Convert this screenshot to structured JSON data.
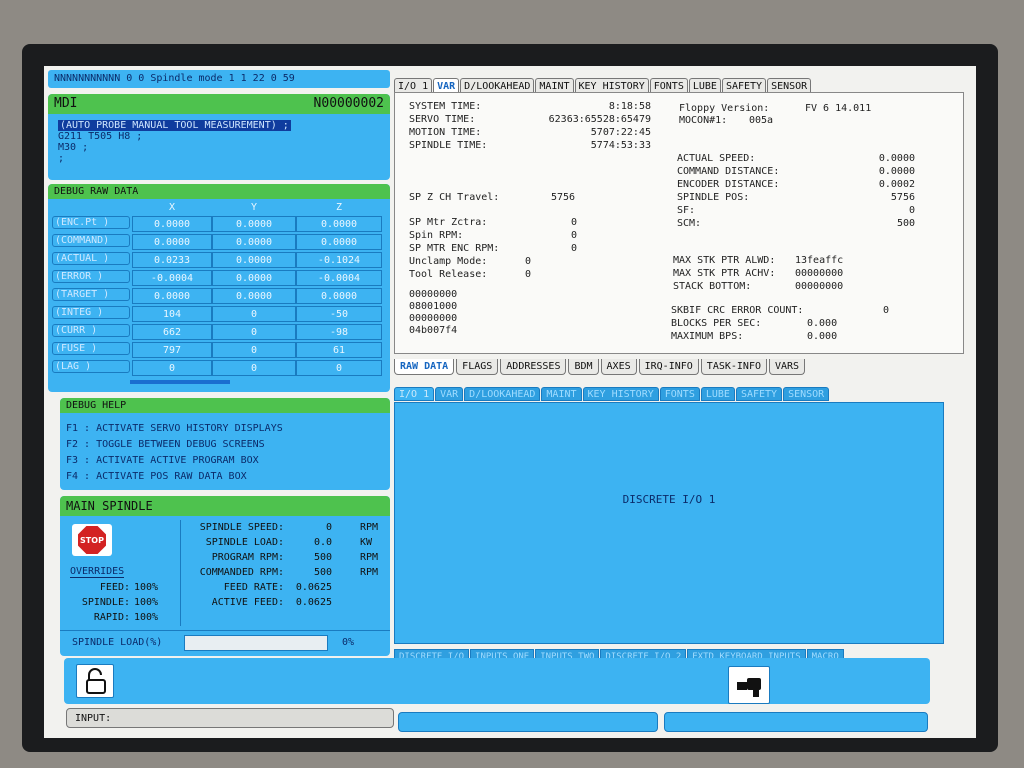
{
  "status_bar": {
    "text": "NNNNNNNNNNN   0   0 Spindle mode 1  1  22   0  59"
  },
  "mdi": {
    "title": "MDI",
    "program_number": "N00000002",
    "lines": [
      "(AUTO PROBE MANUAL TOOL MEASUREMENT) ;",
      "G211 T505 H8 ;",
      "M30 ;",
      ";"
    ]
  },
  "debug_raw": {
    "title": "DEBUG RAW DATA",
    "columns": [
      "X",
      "Y",
      "Z"
    ],
    "rows": [
      {
        "label": "(ENC.Pt )",
        "values": [
          "0.0000",
          "0.0000",
          "0.0000"
        ]
      },
      {
        "label": "(COMMAND)",
        "values": [
          "0.0000",
          "0.0000",
          "0.0000"
        ]
      },
      {
        "label": "(ACTUAL )",
        "values": [
          "0.0233",
          "0.0000",
          "-0.1024"
        ]
      },
      {
        "label": "(ERROR  )",
        "values": [
          "-0.0004",
          "0.0000",
          "-0.0004"
        ]
      },
      {
        "label": "(TARGET )",
        "values": [
          "0.0000",
          "0.0000",
          "0.0000"
        ]
      },
      {
        "label": "(INTEG  )",
        "values": [
          "104",
          "0",
          "-50"
        ]
      },
      {
        "label": "(CURR   )",
        "values": [
          "662",
          "0",
          "-98"
        ]
      },
      {
        "label": "(FUSE   )",
        "values": [
          "797",
          "0",
          "61"
        ]
      },
      {
        "label": "(LAG    )",
        "values": [
          "0",
          "0",
          "0"
        ]
      }
    ]
  },
  "debug_help": {
    "title": "DEBUG HELP",
    "lines": [
      "F1 : ACTIVATE SERVO HISTORY DISPLAYS",
      "F2 : TOGGLE BETWEEN DEBUG SCREENS",
      "F3 : ACTIVATE ACTIVE PROGRAM BOX",
      "F4 : ACTIVATE POS RAW DATA BOX"
    ]
  },
  "main_spindle": {
    "title": "MAIN SPINDLE",
    "stop_label": "STOP",
    "overrides_title": "OVERRIDES",
    "overrides": [
      {
        "label": "FEED:",
        "value": "100%"
      },
      {
        "label": "SPINDLE:",
        "value": "100%"
      },
      {
        "label": "RAPID:",
        "value": "100%"
      }
    ],
    "stats": [
      {
        "label": "SPINDLE SPEED:",
        "value": "0",
        "unit": "RPM"
      },
      {
        "label": "SPINDLE LOAD:",
        "value": "0.0",
        "unit": "KW"
      },
      {
        "label": "PROGRAM RPM:",
        "value": "500",
        "unit": "RPM"
      },
      {
        "label": "COMMANDED RPM:",
        "value": "500",
        "unit": "RPM"
      },
      {
        "label": "FEED RATE:",
        "value": "0.0625",
        "unit": ""
      },
      {
        "label": "ACTIVE FEED:",
        "value": "0.0625",
        "unit": ""
      }
    ],
    "load_label": "SPINDLE LOAD(%)",
    "load_value": "0%",
    "load_fraction": 0
  },
  "top_tabs": [
    "I/O 1",
    "VAR",
    "D/LOOKAHEAD",
    "MAINT",
    "KEY HISTORY",
    "FONTS",
    "LUBE",
    "SAFETY",
    "SENSOR"
  ],
  "top_active_tab": 1,
  "var": {
    "times": [
      {
        "label": "SYSTEM TIME:",
        "value": "8:18:58"
      },
      {
        "label": "SERVO TIME:",
        "value": "62363:65528:65479"
      },
      {
        "label": "MOTION TIME:",
        "value": "5707:22:45"
      },
      {
        "label": "SPINDLE TIME:",
        "value": "5774:53:33"
      }
    ],
    "floppy_version_label": "Floppy Version:",
    "floppy_version_value": "FV 6  14.011",
    "mocon_label": "MOCON#1:",
    "mocon_value": "005a",
    "right_stats": [
      {
        "label": "ACTUAL SPEED:",
        "value": "0.0000"
      },
      {
        "label": "COMMAND DISTANCE:",
        "value": "0.0000"
      },
      {
        "label": "ENCODER DISTANCE:",
        "value": "0.0002"
      },
      {
        "label": "SPINDLE POS:",
        "value": "5756"
      },
      {
        "label": "SF:",
        "value": "0"
      },
      {
        "label": "SCM:",
        "value": "500"
      }
    ],
    "sp_z_label": "SP Z CH Travel:",
    "sp_z_value": "5756",
    "sp_rows": [
      {
        "label": "SP Mtr Zctra:",
        "value": "0"
      },
      {
        "label": "Spin RPM:",
        "value": "0"
      },
      {
        "label": "SP MTR ENC RPM:",
        "value": "0"
      },
      {
        "label": "Unclamp Mode:",
        "value": "0"
      },
      {
        "label": "Tool Release:",
        "value": "0"
      }
    ],
    "stack": [
      {
        "label": "MAX STK PTR ALWD:",
        "value": "13feaffc"
      },
      {
        "label": "MAX STK PTR ACHV:",
        "value": "00000000"
      },
      {
        "label": "STACK BOTTOM:",
        "value": "00000000"
      }
    ],
    "hex_lines": [
      "00000000",
      "08001000",
      "00000000",
      "04b007f4"
    ],
    "crc": [
      {
        "label": "SKBIF CRC ERROR COUNT:",
        "value": "0"
      },
      {
        "label": "BLOCKS PER SEC:",
        "value": "0.000"
      },
      {
        "label": "MAXIMUM BPS:",
        "value": "0.000"
      }
    ]
  },
  "bottom_tabs": [
    "RAW DATA",
    "FLAGS",
    "ADDRESSES",
    "BDM",
    "AXES",
    "IRQ-INFO",
    "TASK-INFO",
    "VARS"
  ],
  "bottom_active_tab": 0,
  "discrete_tabs": [
    "I/O 1",
    "VAR",
    "D/LOOKAHEAD",
    "MAINT",
    "KEY HISTORY",
    "FONTS",
    "LUBE",
    "SAFETY",
    "SENSOR"
  ],
  "discrete_title": "DISCRETE I/O 1",
  "discrete_bottom_tabs": [
    "DISCRETE I/O",
    "INPUTS ONE",
    "INPUTS TWO",
    "DISCRETE I/O 2",
    "EXTD KEYBOARD INPUTS",
    "MACRO"
  ],
  "footer": {
    "input_label": "INPUT:"
  },
  "colors": {
    "header_green": "#4ec24e",
    "panel_blue": "#3db3f2",
    "tab_active": "#1565c0"
  }
}
